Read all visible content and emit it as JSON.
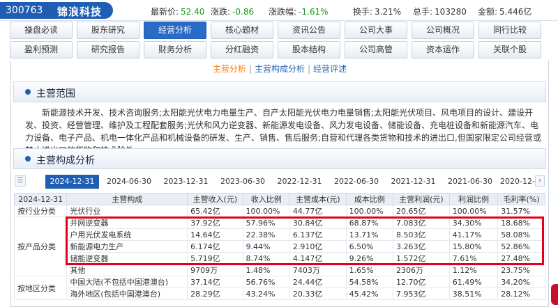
{
  "stock": {
    "code": "300763",
    "name": "锦浪科技"
  },
  "quote": [
    {
      "label": "最新价:",
      "value": "52.40",
      "color": "#1a9a1a"
    },
    {
      "label": "涨跌:",
      "value": "-0.86",
      "color": "#1a9a1a"
    },
    {
      "label": "涨跌幅:",
      "value": "-1.61%",
      "color": "#1a9a1a"
    },
    {
      "label": "换手:",
      "value": "3.21%",
      "color": "#333333"
    },
    {
      "label": "总手:",
      "value": "103280",
      "color": "#333333"
    },
    {
      "label": "金额:",
      "value": "5.446亿",
      "color": "#333333"
    }
  ],
  "nav": {
    "row1": [
      "操盘必读",
      "股东研究",
      "经营分析",
      "核心题材",
      "资讯公告",
      "公司大事",
      "公司概况",
      "同行比较"
    ],
    "row2": [
      "盈利预测",
      "研究报告",
      "财务分析",
      "分红融资",
      "股本结构",
      "公司高管",
      "资本运作",
      "关联个股"
    ],
    "active": "经营分析"
  },
  "subnav": {
    "items": [
      "主营分析",
      "主营构成分析",
      "经营评述"
    ],
    "active": "主营分析"
  },
  "sections": {
    "scope_title": "主营范围",
    "composition_title": "主营构成分析"
  },
  "scope_text": "新能源技术开发、技术咨询服务;太阳能光伏电力电量生产、自产太阳能光伏电力电量销售;太阳能光伏项目、风电项目的设计、建设开发、投资、经营管理、维护及工程配套服务;光伏和风力逆变器、新能源发电设备、风力发电设备、储能设备、充电桩设备和新能源汽车、电力设备、电子产品、机电一体化产品和机械设备的研发、生产、销售、售后服务;自营和代理各类货物和技术的进出口,但国家限定公司经营或禁止进出口的货物和技术除外。",
  "dates": [
    "2024-12-31",
    "2024-06-30",
    "2023-12-31",
    "2023-06-30",
    "2022-12-31",
    "2022-06-30",
    "2021-12-31",
    "2021-06-30",
    "2020-12-"
  ],
  "active_date": "2024-12-31",
  "table": {
    "headers": [
      "2024-12-31",
      "主营构成",
      "主营收入(元)",
      "收入比例",
      "主营成本(元)",
      "成本比例",
      "主营利润(元)",
      "利润比例",
      "毛利率(%)"
    ],
    "groups": [
      {
        "category": "按行业分类",
        "rows": [
          [
            "光伏行业",
            "65.42亿",
            "100.00%",
            "44.77亿",
            "100.00%",
            "20.65亿",
            "100.00%",
            "31.57%"
          ]
        ]
      },
      {
        "category": "按产品分类",
        "rows": [
          [
            "并网逆变器",
            "37.92亿",
            "57.96%",
            "30.84亿",
            "68.87%",
            "7.083亿",
            "34.30%",
            "18.68%"
          ],
          [
            "户用光伏发电系统",
            "14.64亿",
            "22.38%",
            "6.137亿",
            "13.71%",
            "8.503亿",
            "41.17%",
            "58.08%"
          ],
          [
            "新能源电力生产",
            "6.174亿",
            "9.44%",
            "2.910亿",
            "6.50%",
            "3.263亿",
            "15.80%",
            "52.86%"
          ],
          [
            "储能逆变器",
            "5.719亿",
            "8.74%",
            "4.147亿",
            "9.26%",
            "1.572亿",
            "7.61%",
            "27.48%"
          ],
          [
            "其他",
            "9709万",
            "1.48%",
            "7403万",
            "1.65%",
            "2306万",
            "1.12%",
            "23.75%"
          ]
        ]
      },
      {
        "category": "按地区分类",
        "rows": [
          [
            "中国大陆(不包括中国港澳台)",
            "37.14亿",
            "56.76%",
            "24.44亿",
            "54.58%",
            "12.70亿",
            "61.49%",
            "34.20%"
          ],
          [
            "海外地区(包括中国港澳台)",
            "28.29亿",
            "43.24%",
            "20.33亿",
            "45.42%",
            "7.953亿",
            "38.51%",
            "28.12%"
          ]
        ]
      }
    ]
  }
}
